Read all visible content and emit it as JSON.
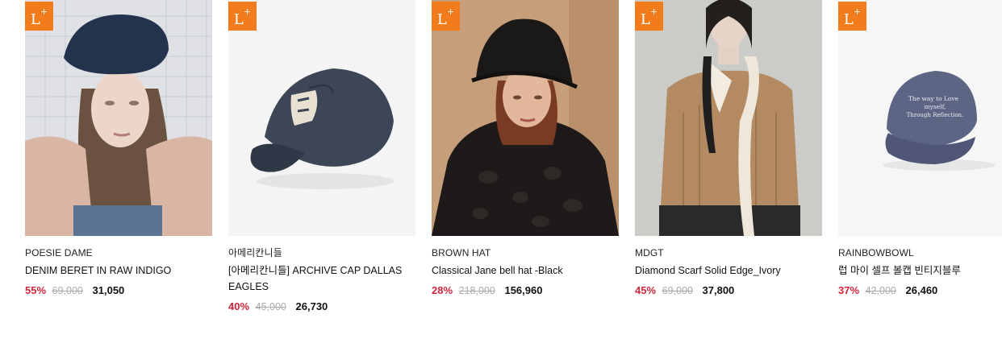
{
  "badge": {
    "main": "L",
    "sup": "+"
  },
  "products": [
    {
      "brand": "POESIE DAME",
      "name": "DENIM BERET IN RAW INDIGO",
      "discount": "55%",
      "original_price": "69,000",
      "sale_price": "31,050"
    },
    {
      "brand": "아메리칸니들",
      "name": "[아메리칸니들] ARCHIVE CAP DALLAS EAGLES",
      "discount": "40%",
      "original_price": "45,000",
      "sale_price": "26,730"
    },
    {
      "brand": "BROWN HAT",
      "name": "Classical Jane bell hat -Black",
      "discount": "28%",
      "original_price": "218,000",
      "sale_price": "156,960"
    },
    {
      "brand": "MDGT",
      "name": "Diamond Scarf Solid Edge_Ivory",
      "discount": "45%",
      "original_price": "69,000",
      "sale_price": "37,800"
    },
    {
      "brand": "RAINBOWBOWL",
      "name": "럽 마이 셀프 볼캡 빈티지블루",
      "discount": "37%",
      "original_price": "42,000",
      "sale_price": "26,460"
    }
  ],
  "cap_embroidery": [
    "The way to Love",
    "myself,",
    "Through Reflection."
  ],
  "colors": {
    "badge": "#f27c1c",
    "discount": "#d0253a",
    "strike": "#aaaaaa"
  }
}
